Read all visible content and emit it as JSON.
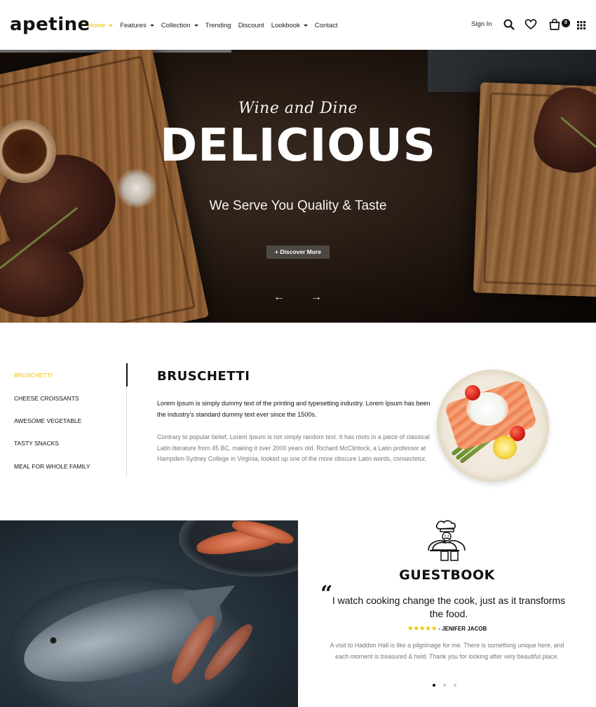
{
  "brand": {
    "logo": "apetine"
  },
  "nav": {
    "items": [
      {
        "label": "Home",
        "active": true,
        "dropdown": true
      },
      {
        "label": "Features",
        "active": false,
        "dropdown": true
      },
      {
        "label": "Collection",
        "active": false,
        "dropdown": true
      },
      {
        "label": "Trending",
        "active": false,
        "dropdown": false
      },
      {
        "label": "Discount",
        "active": false,
        "dropdown": false
      },
      {
        "label": "Lookbook",
        "active": false,
        "dropdown": true
      },
      {
        "label": "Contact",
        "active": false,
        "dropdown": false
      }
    ],
    "signin": "Sign In",
    "cart_count": "0",
    "icons": [
      "search-icon",
      "heart-icon",
      "bag-icon",
      "grid-menu-icon"
    ]
  },
  "hero": {
    "script": "Wine and Dine",
    "title": "DELICIOUS",
    "subtitle": "We Serve You Quality & Taste",
    "button": "+ Discover More",
    "prev_arrow": "←",
    "next_arrow": "→"
  },
  "menu": {
    "items": [
      {
        "label": "BRUSCHETTI",
        "active": true
      },
      {
        "label": "CHEESE CROISSANTS",
        "active": false
      },
      {
        "label": "AWESOME VEGETABLE",
        "active": false
      },
      {
        "label": "TASTY SNACKS",
        "active": false
      },
      {
        "label": "MEAL FOR WHOLE FAMILY",
        "active": false
      }
    ]
  },
  "dish": {
    "title": "BRUSCHETTI",
    "lead": "Lorem Ipsum is simply dummy text of the printing and typesetting industry. Lorem Ipsum has been the industry's standard dummy text ever since the 1500s.",
    "body": "Contrary to popular belief, Lorem Ipsum is not simply random text. It has roots in a piece of classical Latin literature from 45 BC, making it over 2000 years old. Richard McClintock, a Latin professor at Hampden-Sydney College in Virginia, looked up one of the more obscure Latin words, consectetur,"
  },
  "guestbook": {
    "title": "GUESTBOOK",
    "quote": "I watch cooking change the cook, just as it transforms the food.",
    "stars": "★★★★★",
    "author": "- JENIFER JACOB",
    "body": "A visit to Haddon Hall is like a pilgrimage for me. There is something unique here, and each moment is treasured & held. Thank you for looking after very beautiful place.",
    "slides": 3,
    "active_slide": 1
  },
  "colors": {
    "accent": "#f2c200",
    "text": "#111111",
    "muted": "#777777"
  }
}
